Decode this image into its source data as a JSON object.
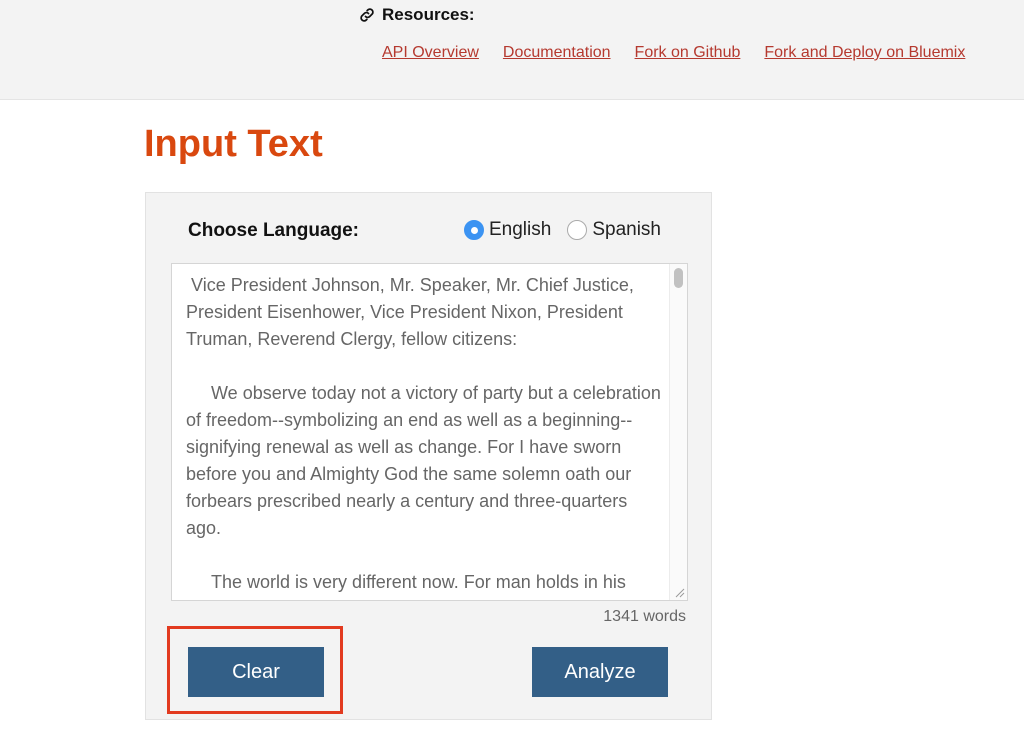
{
  "header": {
    "resources_label": "Resources:",
    "links": [
      {
        "label": "API Overview"
      },
      {
        "label": "Documentation"
      },
      {
        "label": "Fork on Github"
      },
      {
        "label": "Fork and Deploy on Bluemix"
      }
    ]
  },
  "main": {
    "title": "Input Text",
    "language": {
      "label": "Choose Language:",
      "options": [
        {
          "label": "English",
          "selected": true
        },
        {
          "label": "Spanish",
          "selected": false
        }
      ]
    },
    "input_text": " Vice President Johnson, Mr. Speaker, Mr. Chief Justice, President Eisenhower, Vice President Nixon, President Truman, Reverend Clergy, fellow citizens:\n\n     We observe today not a victory of party but a celebration of freedom--symbolizing an end as well as a beginning--signifying renewal as well as change. For I have sworn before you and Almighty God the same solemn oath our forbears prescribed nearly a century and three-quarters ago.\n\n     The world is very different now. For man holds in his mortal hands the power to abolish all forms of",
    "word_count": "1341 words",
    "buttons": {
      "clear": "Clear",
      "analyze": "Analyze"
    }
  },
  "colors": {
    "accent_title": "#d9480f",
    "link": "#b5392f",
    "button": "#335f87",
    "radio_selected": "#3b93f2",
    "highlight": "#e23a1f"
  }
}
